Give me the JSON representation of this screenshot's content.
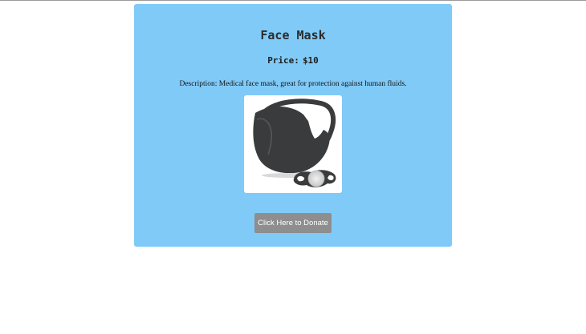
{
  "product": {
    "title": "Face Mask",
    "price_label": "Price:",
    "price_value": "$10",
    "description_label": "Description:",
    "description_text": "Medical face mask, great for protection against human fluids.",
    "image": {
      "icon": "face-mask-image",
      "background": "#ffffff",
      "mask_color": "#3a3b3d"
    }
  },
  "actions": {
    "donate_label": "Click Here to Donate"
  },
  "colors": {
    "card_background": "#80caf8",
    "button_background": "#8e8e8e",
    "button_text": "#ffffff"
  }
}
